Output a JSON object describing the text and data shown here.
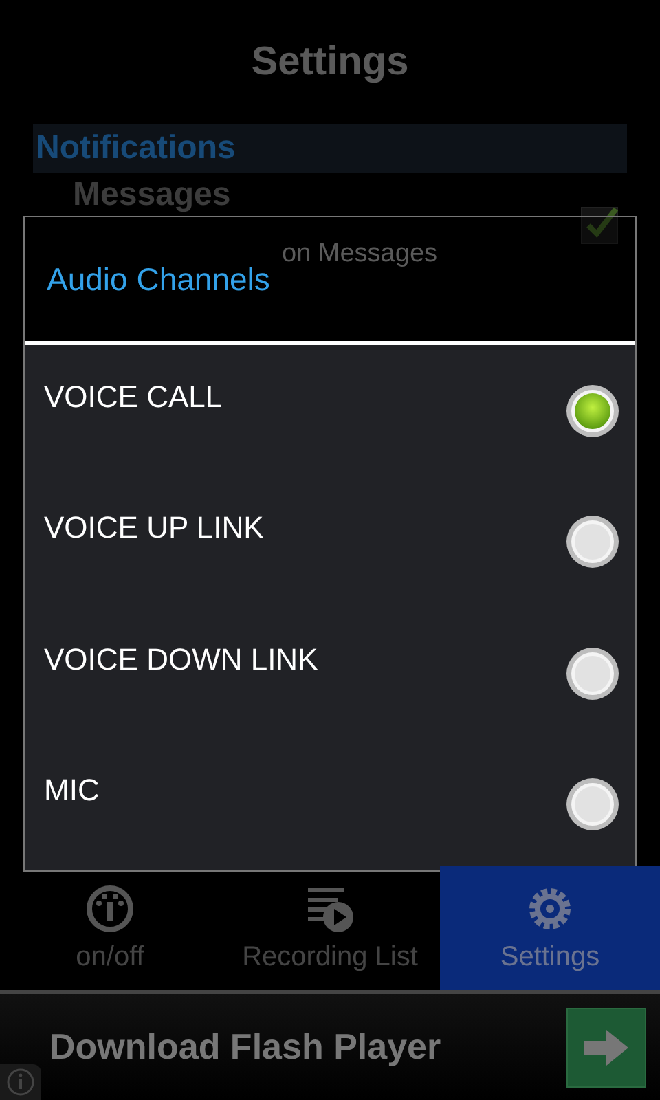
{
  "screen_title": "Settings",
  "category": "Notifications",
  "preferences": [
    {
      "title": "Messages",
      "summary": "on Messages",
      "checked": true
    }
  ],
  "dialog": {
    "title": "Audio Channels",
    "options": [
      {
        "label": "VOICE CALL",
        "selected": true
      },
      {
        "label": "VOICE UP LINK",
        "selected": false
      },
      {
        "label": "VOICE DOWN LINK",
        "selected": false
      },
      {
        "label": "MIC",
        "selected": false
      }
    ]
  },
  "tabs": [
    {
      "label": "on/off",
      "selected": false
    },
    {
      "label": "Recording List",
      "selected": false
    },
    {
      "label": "Settings",
      "selected": true
    }
  ],
  "ad": {
    "text": "Download Flash Player"
  }
}
